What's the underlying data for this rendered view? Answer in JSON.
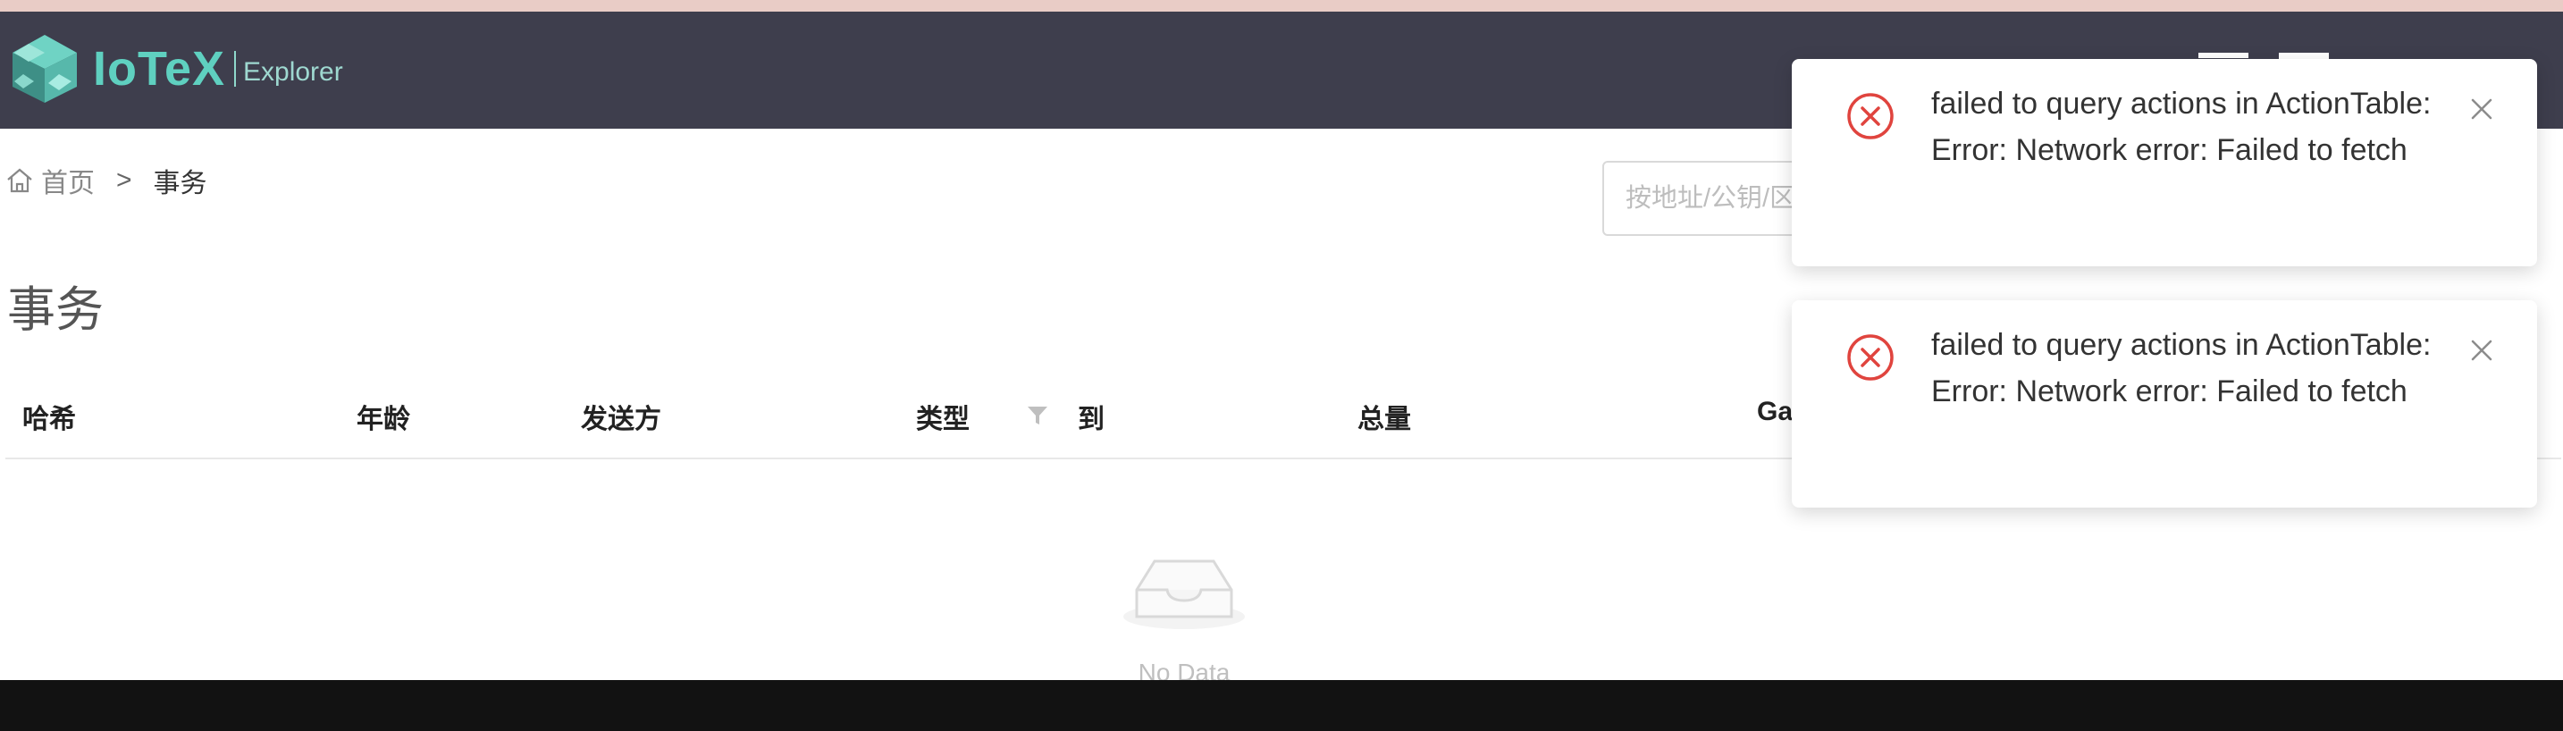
{
  "header": {
    "logo_text": "IoTeX",
    "logo_sub": "Explorer"
  },
  "breadcrumb": {
    "home_label": "首页",
    "separator": ">",
    "current": "事务"
  },
  "search": {
    "placeholder": "按地址/公钥/区块/事务搜索"
  },
  "page": {
    "title": "事务"
  },
  "table": {
    "columns": [
      "哈希",
      "年龄",
      "发送方",
      "类型",
      "到",
      "总量",
      "Gas"
    ],
    "empty_text": "No Data"
  },
  "toasts": [
    {
      "message": "failed to query actions in ActionTable: Error: Network error: Failed to fetch"
    },
    {
      "message": "failed to query actions in ActionTable: Error: Network error: Failed to fetch"
    }
  ],
  "colors": {
    "header_bg": "#3e3e4d",
    "accent": "#5fd0c0",
    "error": "#e0443e",
    "bottom_bar": "#121212"
  },
  "icons": {
    "home": "home-icon",
    "filter": "filter-icon",
    "empty": "empty-inbox-icon",
    "error": "error-circle-icon",
    "close": "close-icon"
  }
}
